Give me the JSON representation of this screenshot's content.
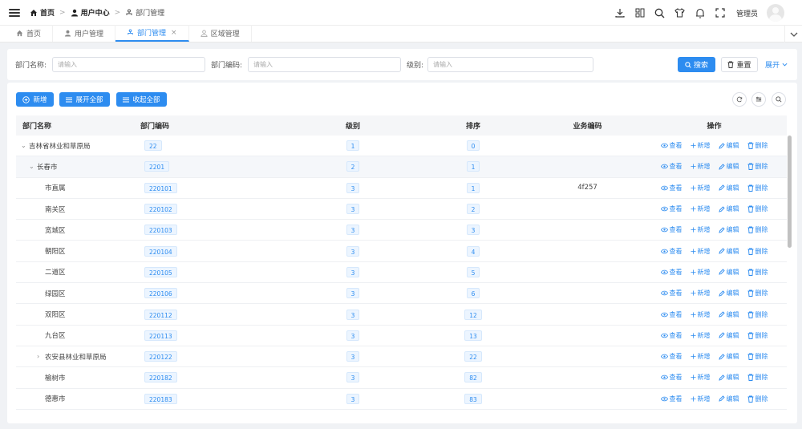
{
  "breadcrumb": [
    "首页",
    "用户中心",
    "部门管理"
  ],
  "header": {
    "username": "管理员"
  },
  "tabs": [
    {
      "label": "首页",
      "active": false
    },
    {
      "label": "用户管理",
      "active": false
    },
    {
      "label": "部门管理",
      "active": true
    },
    {
      "label": "区域管理",
      "active": false
    }
  ],
  "search": {
    "fields": [
      {
        "label": "部门名称:",
        "placeholder": "请输入"
      },
      {
        "label": "部门编码:",
        "placeholder": "请输入"
      },
      {
        "label": "级别:",
        "placeholder": "请输入"
      }
    ],
    "search_label": "搜索",
    "reset_label": "重置",
    "expand_label": "展开"
  },
  "toolbar": {
    "add_label": "新增",
    "expand_all_label": "展开全部",
    "collapse_all_label": "收起全部"
  },
  "table": {
    "headers": [
      "部门名称",
      "部门编码",
      "级别",
      "排序",
      "业务编码",
      "操作"
    ],
    "actions": [
      "查看",
      "新增",
      "编辑",
      "删除"
    ],
    "rows": [
      {
        "name": "吉林省林业和草原局",
        "code": "22",
        "level": "1",
        "sort": "0",
        "biz": "",
        "indent": 0,
        "toggle": "open"
      },
      {
        "name": "长春市",
        "code": "2201",
        "level": "2",
        "sort": "1",
        "biz": "",
        "indent": 1,
        "toggle": "open"
      },
      {
        "name": "市直属",
        "code": "220101",
        "level": "3",
        "sort": "1",
        "biz": "4f257",
        "indent": 2,
        "toggle": ""
      },
      {
        "name": "南关区",
        "code": "220102",
        "level": "3",
        "sort": "2",
        "biz": "",
        "indent": 2,
        "toggle": ""
      },
      {
        "name": "宽城区",
        "code": "220103",
        "level": "3",
        "sort": "3",
        "biz": "",
        "indent": 2,
        "toggle": ""
      },
      {
        "name": "朝阳区",
        "code": "220104",
        "level": "3",
        "sort": "4",
        "biz": "",
        "indent": 2,
        "toggle": ""
      },
      {
        "name": "二道区",
        "code": "220105",
        "level": "3",
        "sort": "5",
        "biz": "",
        "indent": 2,
        "toggle": ""
      },
      {
        "name": "绿园区",
        "code": "220106",
        "level": "3",
        "sort": "6",
        "biz": "",
        "indent": 2,
        "toggle": ""
      },
      {
        "name": "双阳区",
        "code": "220112",
        "level": "3",
        "sort": "12",
        "biz": "",
        "indent": 2,
        "toggle": ""
      },
      {
        "name": "九台区",
        "code": "220113",
        "level": "3",
        "sort": "13",
        "biz": "",
        "indent": 2,
        "toggle": ""
      },
      {
        "name": "农安县林业和草原局",
        "code": "220122",
        "level": "3",
        "sort": "22",
        "biz": "",
        "indent": 2,
        "toggle": "closed"
      },
      {
        "name": "榆树市",
        "code": "220182",
        "level": "3",
        "sort": "82",
        "biz": "",
        "indent": 2,
        "toggle": ""
      },
      {
        "name": "德惠市",
        "code": "220183",
        "level": "3",
        "sort": "83",
        "biz": "",
        "indent": 2,
        "toggle": ""
      },
      {
        "name": "",
        "code": "",
        "level": "",
        "sort": "",
        "biz": "",
        "indent": 2,
        "toggle": ""
      }
    ]
  }
}
